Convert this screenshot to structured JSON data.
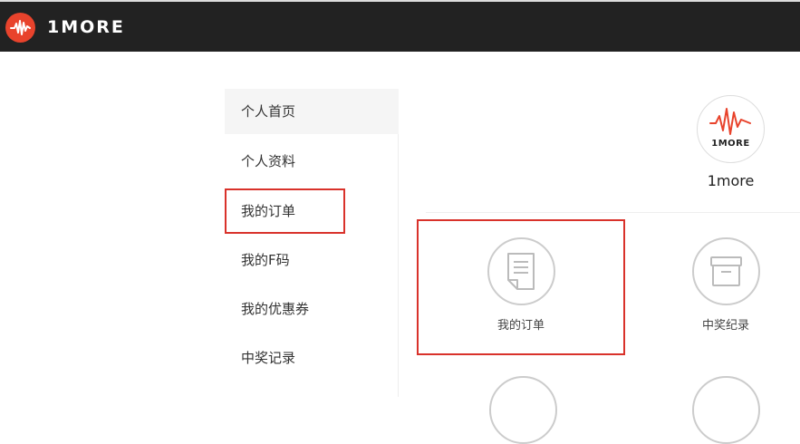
{
  "header": {
    "brand": "1MORE",
    "logo_color": "#e8432c",
    "bar_color": "#222222"
  },
  "sidebar": {
    "items": [
      {
        "label": "个人首页",
        "state": "active"
      },
      {
        "label": "个人资料",
        "state": "normal"
      },
      {
        "label": "我的订单",
        "state": "highlighted"
      },
      {
        "label": "我的F码",
        "state": "normal"
      },
      {
        "label": "我的优惠券",
        "state": "normal"
      },
      {
        "label": "中奖记录",
        "state": "normal"
      }
    ]
  },
  "profile": {
    "avatar_text": "1MORE",
    "username": "1more"
  },
  "cards": [
    {
      "label": "我的订单",
      "icon": "document-icon",
      "highlighted": true
    },
    {
      "label": "中奖纪录",
      "icon": "box-icon",
      "highlighted": false
    }
  ],
  "highlight_color": "#d9322b"
}
